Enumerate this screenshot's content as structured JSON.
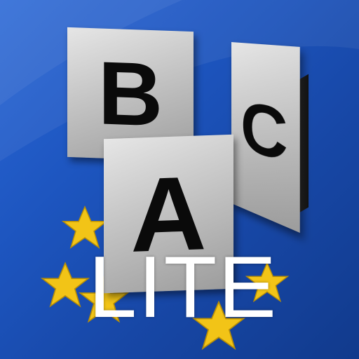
{
  "tiles": {
    "b_letter": "B",
    "c_letter": "C",
    "a_letter": "A"
  },
  "badge": "LITE",
  "colors": {
    "background": "#1d55bf",
    "tile": "#c4c4c4",
    "letter": "#0a0a0a",
    "star": "#f2c417",
    "badge_text": "#ffffff"
  },
  "icons": [
    "eu-star-icon"
  ]
}
